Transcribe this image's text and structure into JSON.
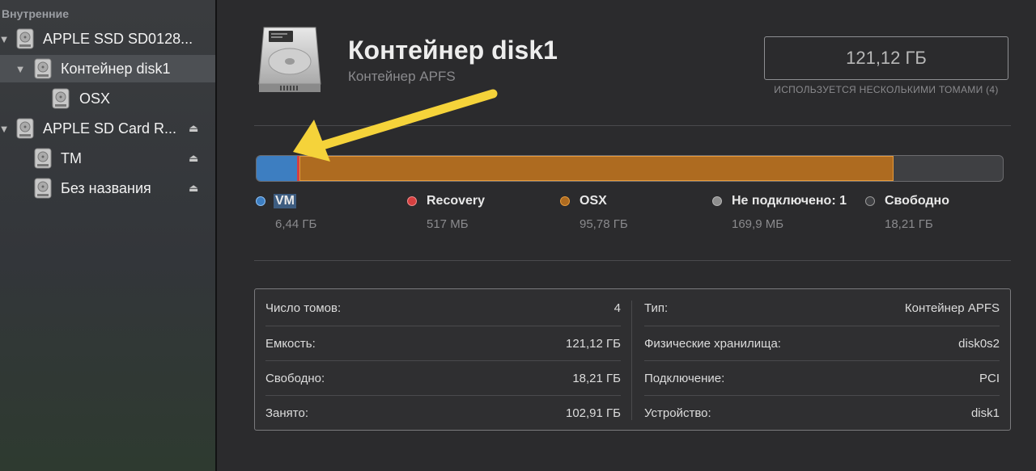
{
  "sidebar": {
    "section_title": "Внутренние",
    "items": [
      {
        "label": "APPLE SSD SD0128...",
        "expanded": true,
        "eject": false
      },
      {
        "label": "Контейнер disk1",
        "expanded": true,
        "eject": false,
        "selected": true
      },
      {
        "label": "OSX",
        "eject": false
      },
      {
        "label": "APPLE SD Card R...",
        "expanded": true,
        "eject": true
      },
      {
        "label": "TM",
        "eject": true
      },
      {
        "label": "Без названия",
        "eject": true
      }
    ]
  },
  "header": {
    "title": "Контейнер disk1",
    "subtitle": "Контейнер APFS",
    "capacity": "121,12 ГБ",
    "capacity_note": "ИСПОЛЬЗУЕТСЯ НЕСКОЛЬКИМИ ТОМАМИ (4)"
  },
  "usage": {
    "legend": [
      {
        "name": "VM",
        "size": "6,44 ГБ",
        "color": "#3d7ec1"
      },
      {
        "name": "Recovery",
        "size": "517 МБ",
        "color": "#d64040"
      },
      {
        "name": "OSX",
        "size": "95,78 ГБ",
        "color": "#ae6b20"
      },
      {
        "name": "Не подключено: 1",
        "size": "169,9 МБ",
        "color": "#8e8e8e"
      },
      {
        "name": "Свободно",
        "size": "18,21 ГБ",
        "color": "#3f4043"
      }
    ]
  },
  "info": {
    "left": [
      {
        "key": "Число томов:",
        "value": "4"
      },
      {
        "key": "Емкость:",
        "value": "121,12 ГБ"
      },
      {
        "key": "Свободно:",
        "value": "18,21 ГБ"
      },
      {
        "key": "Занято:",
        "value": "102,91 ГБ"
      }
    ],
    "right": [
      {
        "key": "Тип:",
        "value": "Контейнер APFS"
      },
      {
        "key": "Физические хранилища:",
        "value": "disk0s2"
      },
      {
        "key": "Подключение:",
        "value": "PCI"
      },
      {
        "key": "Устройство:",
        "value": "disk1"
      }
    ]
  },
  "annotation": {
    "arrow_color": "#f5d33a"
  }
}
